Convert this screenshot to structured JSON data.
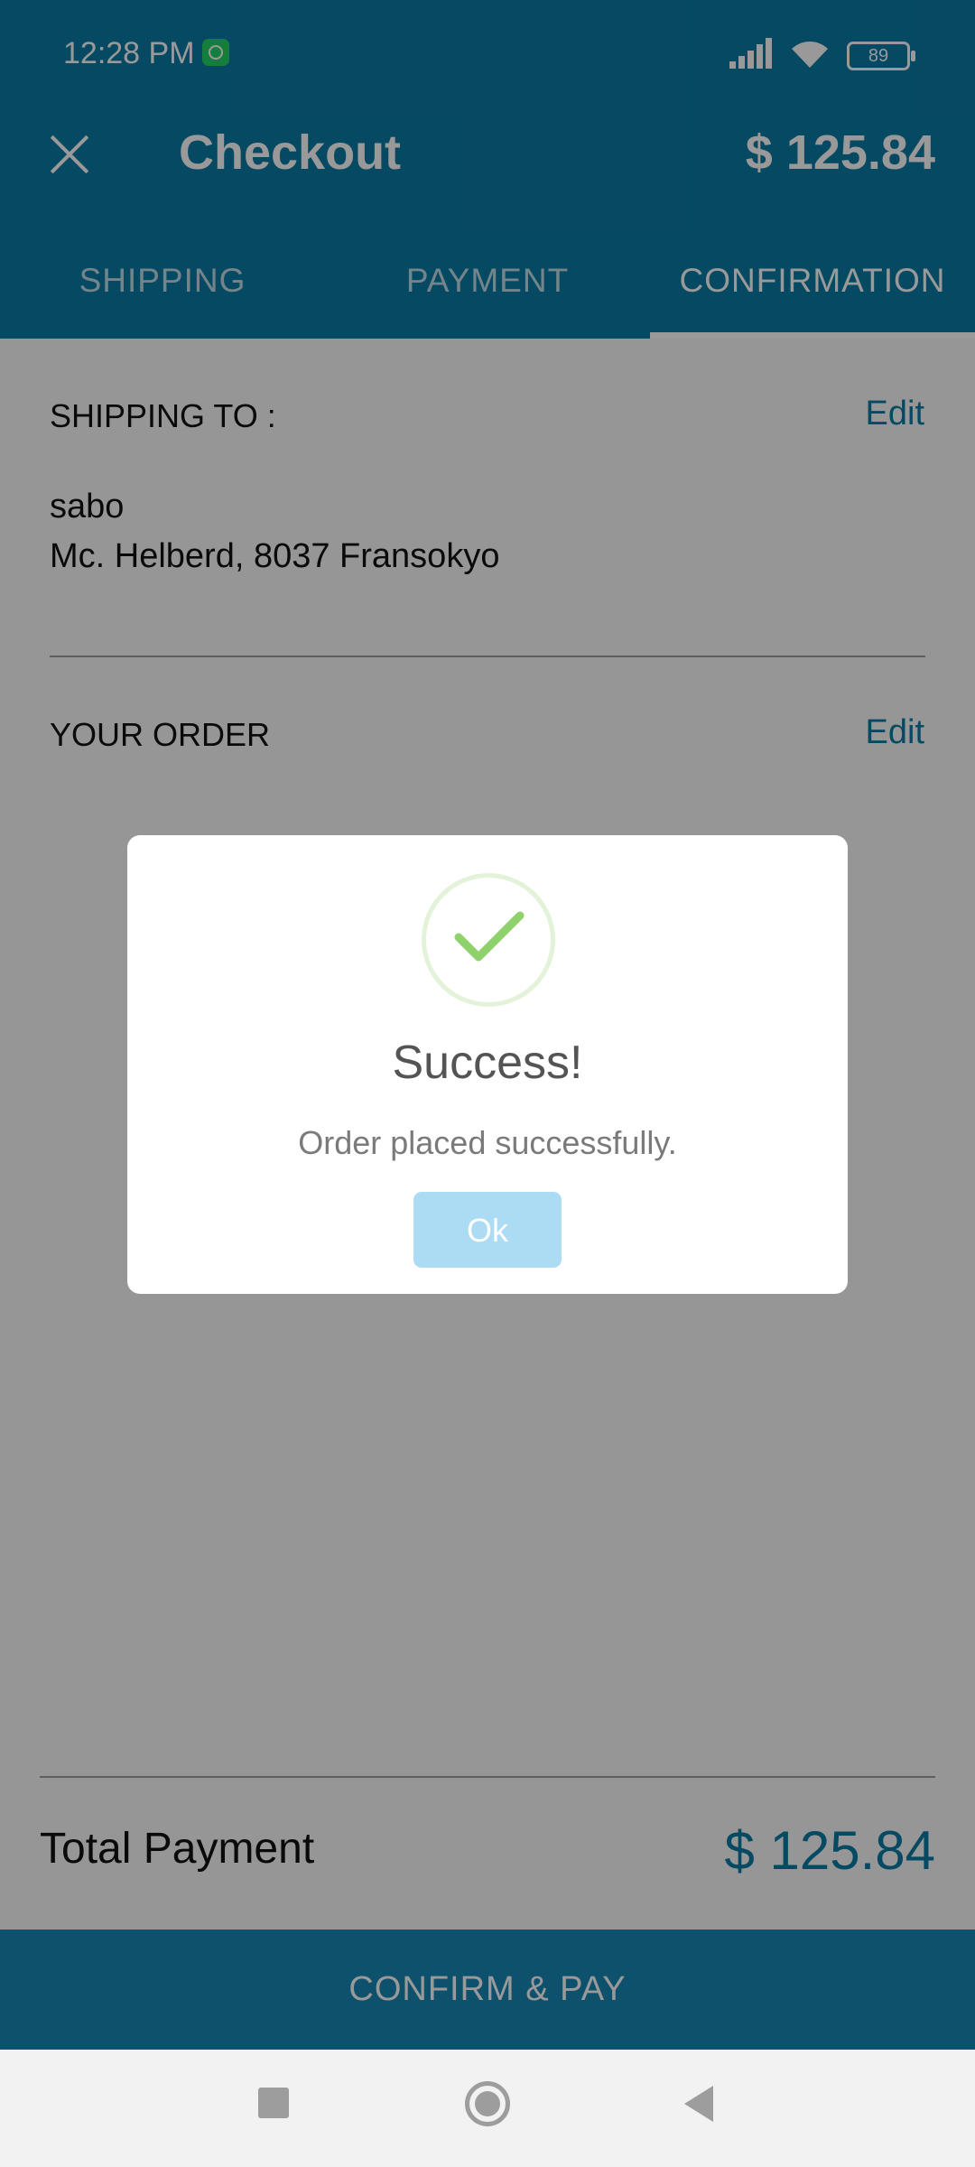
{
  "status_bar": {
    "time": "12:28 PM",
    "battery": "89"
  },
  "toolbar": {
    "title": "Checkout",
    "amount": "$ 125.84"
  },
  "tabs": [
    {
      "label": "SHIPPING",
      "active": false
    },
    {
      "label": "PAYMENT",
      "active": false
    },
    {
      "label": "CONFIRMATION",
      "active": true
    }
  ],
  "shipping": {
    "label": "SHIPPING TO :",
    "edit_label": "Edit",
    "name": "sabo",
    "address": "Mc. Helberd, 8037 Fransokyo"
  },
  "order": {
    "label": "YOUR ORDER",
    "edit_label": "Edit"
  },
  "total": {
    "label": "Total Payment",
    "value": "$ 125.84"
  },
  "confirm_button": "CONFIRM & PAY",
  "dialog": {
    "title": "Success!",
    "message": "Order placed successfully.",
    "ok_label": "Ok"
  },
  "colors": {
    "primary": "#0b7aa3",
    "accent_button": "#1888b6",
    "ok_button": "#acdcf3",
    "success_check": "#8fd16a"
  }
}
